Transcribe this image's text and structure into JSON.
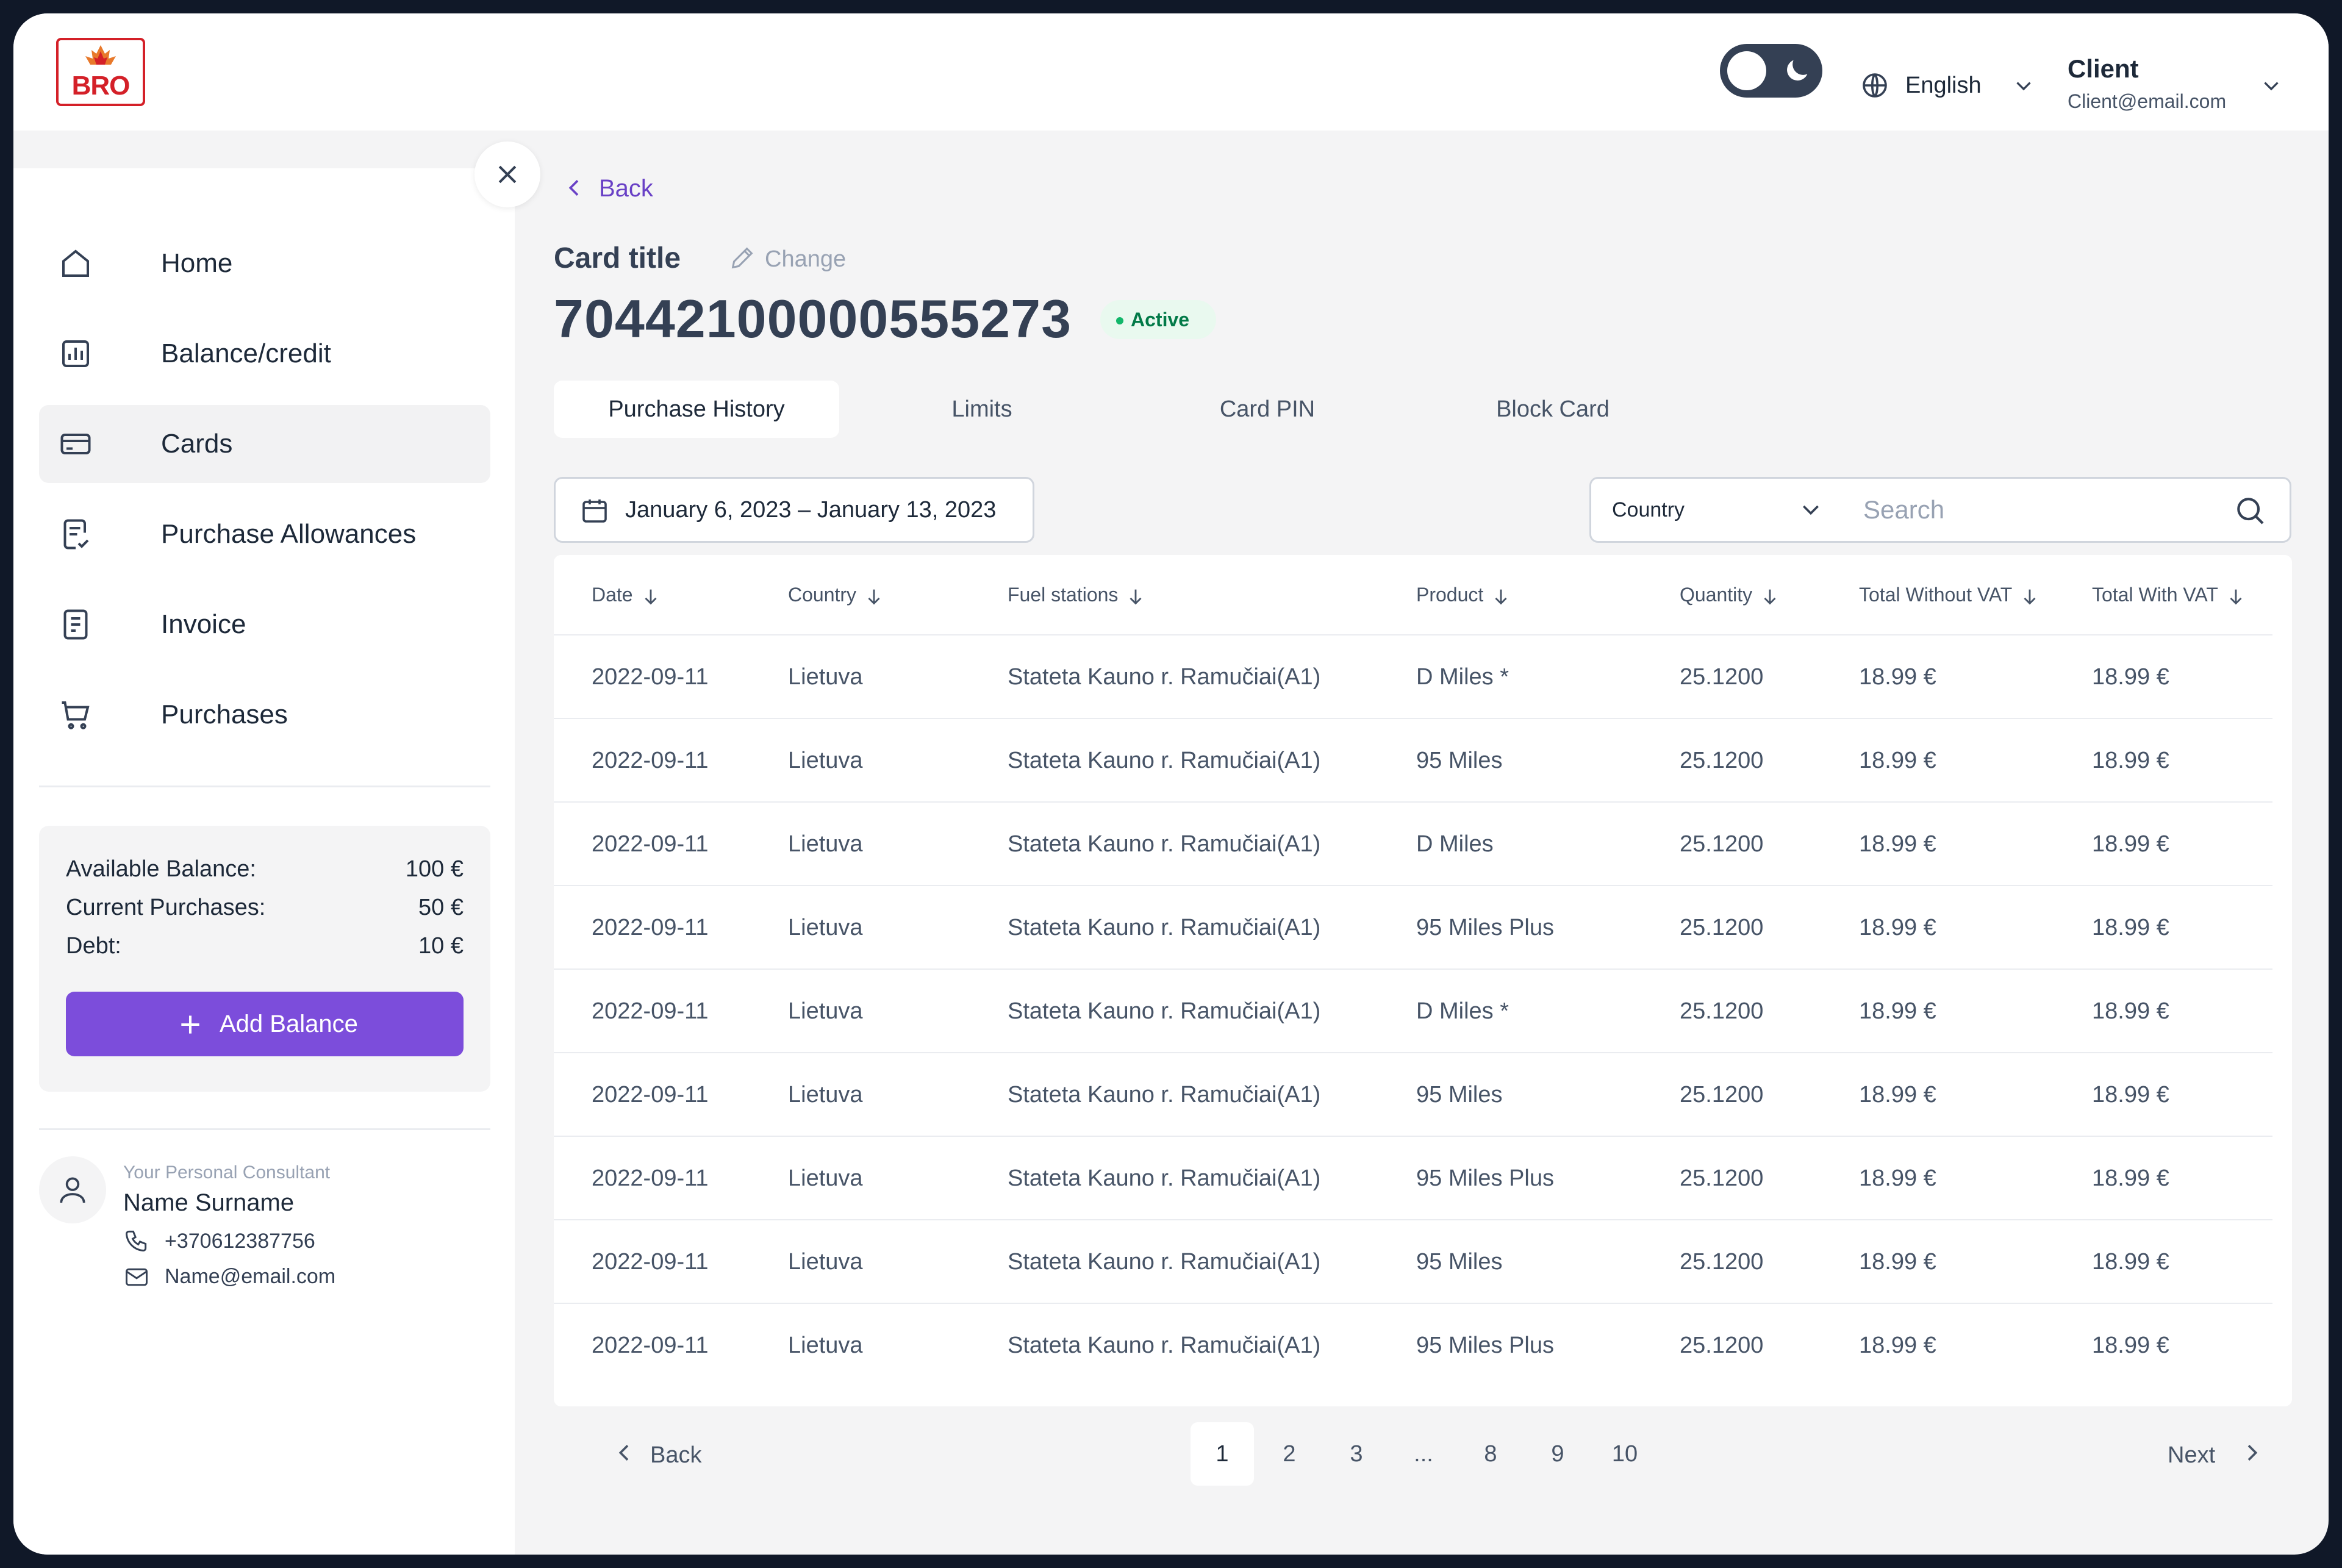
{
  "header": {
    "logo_text": "BRO",
    "language": "English",
    "client_name": "Client",
    "client_email": "Client@email.com"
  },
  "sidebar": {
    "items": [
      {
        "label": "Home",
        "icon": "home-icon"
      },
      {
        "label": "Balance/credit",
        "icon": "chart-icon"
      },
      {
        "label": "Cards",
        "icon": "card-icon",
        "active": true
      },
      {
        "label": "Purchase Allowances",
        "icon": "checklist-icon"
      },
      {
        "label": "Invoice",
        "icon": "document-icon"
      },
      {
        "label": "Purchases",
        "icon": "cart-icon"
      }
    ],
    "balance": {
      "available_label": "Available Balance:",
      "available_value": "100 €",
      "current_label": "Current Purchases:",
      "current_value": "50 €",
      "debt_label": "Debt:",
      "debt_value": "10 €",
      "add_button": "Add Balance"
    },
    "consultant": {
      "caption": "Your Personal Consultant",
      "name": "Name Surname",
      "phone": "+370612387756",
      "email": "Name@email.com"
    }
  },
  "main": {
    "back_label": "Back",
    "card_title": "Card title",
    "change_label": "Change",
    "card_number": "70442100000555273",
    "status": "Active",
    "tabs": [
      "Purchase History",
      "Limits",
      "Card PIN",
      "Block Card"
    ],
    "active_tab": "Purchase History",
    "date_range": "January 6, 2023 – January 13, 2023",
    "country_select": "Country",
    "search_placeholder": "Search"
  },
  "table": {
    "columns": [
      "Date",
      "Country",
      "Fuel stations",
      "Product",
      "Quantity",
      "Total Without VAT",
      "Total With VAT"
    ],
    "rows": [
      [
        "2022-09-11",
        "Lietuva",
        "Stateta Kauno r. Ramučiai(A1)",
        "D Miles *",
        "25.1200",
        "18.99 €",
        "18.99 €"
      ],
      [
        "2022-09-11",
        "Lietuva",
        "Stateta Kauno r. Ramučiai(A1)",
        "95 Miles",
        "25.1200",
        "18.99 €",
        "18.99 €"
      ],
      [
        "2022-09-11",
        "Lietuva",
        "Stateta Kauno r. Ramučiai(A1)",
        "D Miles",
        "25.1200",
        "18.99 €",
        "18.99 €"
      ],
      [
        "2022-09-11",
        "Lietuva",
        "Stateta Kauno r. Ramučiai(A1)",
        "95 Miles Plus",
        "25.1200",
        "18.99 €",
        "18.99 €"
      ],
      [
        "2022-09-11",
        "Lietuva",
        "Stateta Kauno r. Ramučiai(A1)",
        "D Miles *",
        "25.1200",
        "18.99 €",
        "18.99 €"
      ],
      [
        "2022-09-11",
        "Lietuva",
        "Stateta Kauno r. Ramučiai(A1)",
        "95 Miles",
        "25.1200",
        "18.99 €",
        "18.99 €"
      ],
      [
        "2022-09-11",
        "Lietuva",
        "Stateta Kauno r. Ramučiai(A1)",
        "95 Miles Plus",
        "25.1200",
        "18.99 €",
        "18.99 €"
      ],
      [
        "2022-09-11",
        "Lietuva",
        "Stateta Kauno r. Ramučiai(A1)",
        "95 Miles",
        "25.1200",
        "18.99 €",
        "18.99 €"
      ],
      [
        "2022-09-11",
        "Lietuva",
        "Stateta Kauno r. Ramučiai(A1)",
        "95 Miles Plus",
        "25.1200",
        "18.99 €",
        "18.99 €"
      ]
    ]
  },
  "pagination": {
    "back_label": "Back",
    "next_label": "Next",
    "pages": [
      "1",
      "2",
      "3",
      "...",
      "8",
      "9",
      "10"
    ],
    "current": "1"
  },
  "colors": {
    "accent": "#7c4ddb",
    "link": "#6941c6",
    "brand_red": "#d42028",
    "status_green": "#12b76a"
  }
}
